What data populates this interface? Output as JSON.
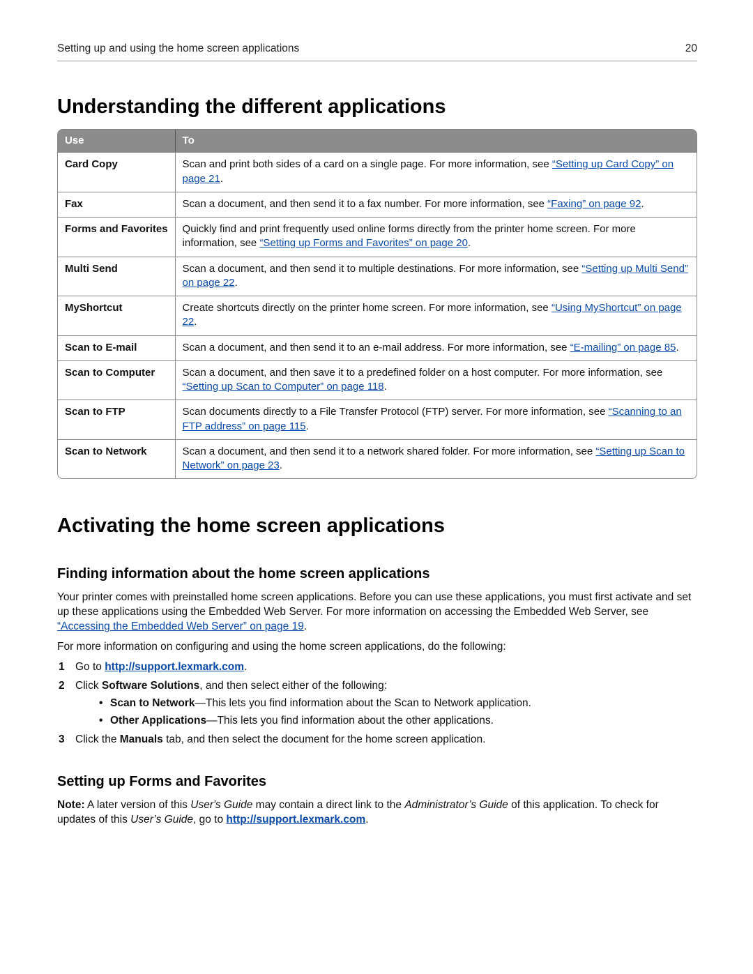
{
  "header": {
    "title": "Setting up and using the home screen applications",
    "page": "20"
  },
  "h1a": "Understanding the different applications",
  "table": {
    "col_use": "Use",
    "col_to": "To",
    "rows": [
      {
        "use": "Card Copy",
        "pre": "Scan and print both sides of a card on a single page. For more information, see ",
        "link": "“Setting up Card Copy” on page 21",
        "post": "."
      },
      {
        "use": "Fax",
        "pre": "Scan a document, and then send it to a fax number. For more information, see ",
        "link": "“Faxing” on page 92",
        "post": "."
      },
      {
        "use": "Forms and Favorites",
        "pre": "Quickly find and print frequently used online forms directly from the printer home screen. For more information, see ",
        "link": "“Setting up Forms and Favorites” on page 20",
        "post": "."
      },
      {
        "use": "Multi Send",
        "pre": "Scan a document, and then send it to multiple destinations. For more information, see ",
        "link": "“Setting up Multi Send” on page 22",
        "post": "."
      },
      {
        "use": "MyShortcut",
        "pre": "Create shortcuts directly on the printer home screen. For more information, see ",
        "link": "“Using MyShortcut” on page 22",
        "post": "."
      },
      {
        "use": "Scan to E-mail",
        "pre": "Scan a document, and then send it to an e-mail address. For more information, see ",
        "link": "“E-mailing” on page 85",
        "post": "."
      },
      {
        "use": "Scan to Computer",
        "pre": "Scan a document, and then save it to a predefined folder on a host computer. For more information, see ",
        "link": "“Setting up Scan to Computer” on page 118",
        "post": "."
      },
      {
        "use": "Scan to FTP",
        "pre": "Scan documents directly to a File Transfer Protocol (FTP) server. For more information, see ",
        "link": "“Scanning to an FTP address” on page 115",
        "post": "."
      },
      {
        "use": "Scan to Network",
        "pre": "Scan a document, and then send it to a network shared folder. For more information, see ",
        "link": "“Setting up Scan to Network” on page 23",
        "post": "."
      }
    ]
  },
  "h1b": "Activating the home screen applications",
  "finding": {
    "heading": "Finding information about the home screen applications",
    "p1_pre": "Your printer comes with preinstalled home screen applications. Before you can use these applications, you must first activate and set up these applications using the Embedded Web Server. For more information on accessing the Embedded Web Server, see ",
    "p1_link": "“Accessing the Embedded Web Server” on page 19",
    "p1_post": ".",
    "p2": "For more information on configuring and using the home screen applications, do the following:",
    "steps": {
      "s1_num": "1",
      "s1_pre": "Go to ",
      "s1_link": "http://support.lexmark.com",
      "s1_post": ".",
      "s2_num": "2",
      "s2_pre": "Click ",
      "s2_bold": "Software Solutions",
      "s2_post": ", and then select either of the following:",
      "b1_bold": "Scan to Network",
      "b1_rest": "—This lets you find information about the Scan to Network application.",
      "b2_bold": "Other Applications",
      "b2_rest": "—This lets you find information about the other applications.",
      "s3_num": "3",
      "s3_pre": "Click the ",
      "s3_bold": "Manuals",
      "s3_post": " tab, and then select the document for the home screen application."
    }
  },
  "setup": {
    "heading": "Setting up Forms and Favorites",
    "note_label": "Note:",
    "t1": " A later version of this ",
    "t2": "User's Guide",
    "t3": " may contain a direct link to the ",
    "t4": "Administrator’s Guide",
    "t5": " of this application. To check for updates of this ",
    "t6": "User’s Guide",
    "t7": ", go to ",
    "link": "http://support.lexmark.com",
    "t8": "."
  }
}
